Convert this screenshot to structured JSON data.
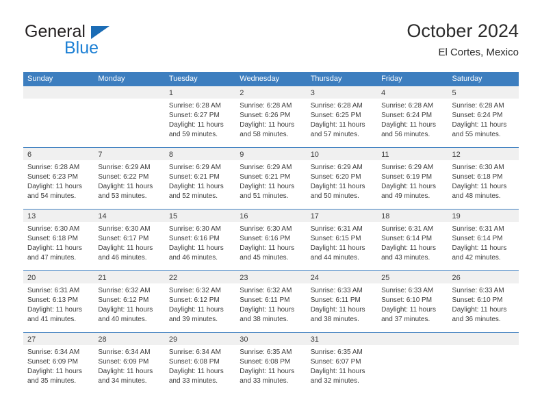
{
  "brand": {
    "name_part1": "General",
    "name_part2": "Blue",
    "triangle_icon": "blue-triangle-logo-icon",
    "color_dark": "#231f20",
    "color_blue": "#1b7fd4"
  },
  "header": {
    "title": "October 2024",
    "subtitle": "El Cortes, Mexico"
  },
  "theme": {
    "header_bar": "#3d7ebf",
    "day_band": "#f0f0f0",
    "text": "#3a3a3a"
  },
  "calendar": {
    "weekday_headers": [
      "Sunday",
      "Monday",
      "Tuesday",
      "Wednesday",
      "Thursday",
      "Friday",
      "Saturday"
    ],
    "weeks": [
      [
        {
          "day": "",
          "sunrise": "",
          "sunset": "",
          "daylight_line1": "",
          "daylight_line2": "",
          "empty": true
        },
        {
          "day": "",
          "sunrise": "",
          "sunset": "",
          "daylight_line1": "",
          "daylight_line2": "",
          "empty": true
        },
        {
          "day": "1",
          "sunrise": "Sunrise: 6:28 AM",
          "sunset": "Sunset: 6:27 PM",
          "daylight_line1": "Daylight: 11 hours",
          "daylight_line2": "and 59 minutes."
        },
        {
          "day": "2",
          "sunrise": "Sunrise: 6:28 AM",
          "sunset": "Sunset: 6:26 PM",
          "daylight_line1": "Daylight: 11 hours",
          "daylight_line2": "and 58 minutes."
        },
        {
          "day": "3",
          "sunrise": "Sunrise: 6:28 AM",
          "sunset": "Sunset: 6:25 PM",
          "daylight_line1": "Daylight: 11 hours",
          "daylight_line2": "and 57 minutes."
        },
        {
          "day": "4",
          "sunrise": "Sunrise: 6:28 AM",
          "sunset": "Sunset: 6:24 PM",
          "daylight_line1": "Daylight: 11 hours",
          "daylight_line2": "and 56 minutes."
        },
        {
          "day": "5",
          "sunrise": "Sunrise: 6:28 AM",
          "sunset": "Sunset: 6:24 PM",
          "daylight_line1": "Daylight: 11 hours",
          "daylight_line2": "and 55 minutes."
        }
      ],
      [
        {
          "day": "6",
          "sunrise": "Sunrise: 6:28 AM",
          "sunset": "Sunset: 6:23 PM",
          "daylight_line1": "Daylight: 11 hours",
          "daylight_line2": "and 54 minutes."
        },
        {
          "day": "7",
          "sunrise": "Sunrise: 6:29 AM",
          "sunset": "Sunset: 6:22 PM",
          "daylight_line1": "Daylight: 11 hours",
          "daylight_line2": "and 53 minutes."
        },
        {
          "day": "8",
          "sunrise": "Sunrise: 6:29 AM",
          "sunset": "Sunset: 6:21 PM",
          "daylight_line1": "Daylight: 11 hours",
          "daylight_line2": "and 52 minutes."
        },
        {
          "day": "9",
          "sunrise": "Sunrise: 6:29 AM",
          "sunset": "Sunset: 6:21 PM",
          "daylight_line1": "Daylight: 11 hours",
          "daylight_line2": "and 51 minutes."
        },
        {
          "day": "10",
          "sunrise": "Sunrise: 6:29 AM",
          "sunset": "Sunset: 6:20 PM",
          "daylight_line1": "Daylight: 11 hours",
          "daylight_line2": "and 50 minutes."
        },
        {
          "day": "11",
          "sunrise": "Sunrise: 6:29 AM",
          "sunset": "Sunset: 6:19 PM",
          "daylight_line1": "Daylight: 11 hours",
          "daylight_line2": "and 49 minutes."
        },
        {
          "day": "12",
          "sunrise": "Sunrise: 6:30 AM",
          "sunset": "Sunset: 6:18 PM",
          "daylight_line1": "Daylight: 11 hours",
          "daylight_line2": "and 48 minutes."
        }
      ],
      [
        {
          "day": "13",
          "sunrise": "Sunrise: 6:30 AM",
          "sunset": "Sunset: 6:18 PM",
          "daylight_line1": "Daylight: 11 hours",
          "daylight_line2": "and 47 minutes."
        },
        {
          "day": "14",
          "sunrise": "Sunrise: 6:30 AM",
          "sunset": "Sunset: 6:17 PM",
          "daylight_line1": "Daylight: 11 hours",
          "daylight_line2": "and 46 minutes."
        },
        {
          "day": "15",
          "sunrise": "Sunrise: 6:30 AM",
          "sunset": "Sunset: 6:16 PM",
          "daylight_line1": "Daylight: 11 hours",
          "daylight_line2": "and 46 minutes."
        },
        {
          "day": "16",
          "sunrise": "Sunrise: 6:30 AM",
          "sunset": "Sunset: 6:16 PM",
          "daylight_line1": "Daylight: 11 hours",
          "daylight_line2": "and 45 minutes."
        },
        {
          "day": "17",
          "sunrise": "Sunrise: 6:31 AM",
          "sunset": "Sunset: 6:15 PM",
          "daylight_line1": "Daylight: 11 hours",
          "daylight_line2": "and 44 minutes."
        },
        {
          "day": "18",
          "sunrise": "Sunrise: 6:31 AM",
          "sunset": "Sunset: 6:14 PM",
          "daylight_line1": "Daylight: 11 hours",
          "daylight_line2": "and 43 minutes."
        },
        {
          "day": "19",
          "sunrise": "Sunrise: 6:31 AM",
          "sunset": "Sunset: 6:14 PM",
          "daylight_line1": "Daylight: 11 hours",
          "daylight_line2": "and 42 minutes."
        }
      ],
      [
        {
          "day": "20",
          "sunrise": "Sunrise: 6:31 AM",
          "sunset": "Sunset: 6:13 PM",
          "daylight_line1": "Daylight: 11 hours",
          "daylight_line2": "and 41 minutes."
        },
        {
          "day": "21",
          "sunrise": "Sunrise: 6:32 AM",
          "sunset": "Sunset: 6:12 PM",
          "daylight_line1": "Daylight: 11 hours",
          "daylight_line2": "and 40 minutes."
        },
        {
          "day": "22",
          "sunrise": "Sunrise: 6:32 AM",
          "sunset": "Sunset: 6:12 PM",
          "daylight_line1": "Daylight: 11 hours",
          "daylight_line2": "and 39 minutes."
        },
        {
          "day": "23",
          "sunrise": "Sunrise: 6:32 AM",
          "sunset": "Sunset: 6:11 PM",
          "daylight_line1": "Daylight: 11 hours",
          "daylight_line2": "and 38 minutes."
        },
        {
          "day": "24",
          "sunrise": "Sunrise: 6:33 AM",
          "sunset": "Sunset: 6:11 PM",
          "daylight_line1": "Daylight: 11 hours",
          "daylight_line2": "and 38 minutes."
        },
        {
          "day": "25",
          "sunrise": "Sunrise: 6:33 AM",
          "sunset": "Sunset: 6:10 PM",
          "daylight_line1": "Daylight: 11 hours",
          "daylight_line2": "and 37 minutes."
        },
        {
          "day": "26",
          "sunrise": "Sunrise: 6:33 AM",
          "sunset": "Sunset: 6:10 PM",
          "daylight_line1": "Daylight: 11 hours",
          "daylight_line2": "and 36 minutes."
        }
      ],
      [
        {
          "day": "27",
          "sunrise": "Sunrise: 6:34 AM",
          "sunset": "Sunset: 6:09 PM",
          "daylight_line1": "Daylight: 11 hours",
          "daylight_line2": "and 35 minutes."
        },
        {
          "day": "28",
          "sunrise": "Sunrise: 6:34 AM",
          "sunset": "Sunset: 6:09 PM",
          "daylight_line1": "Daylight: 11 hours",
          "daylight_line2": "and 34 minutes."
        },
        {
          "day": "29",
          "sunrise": "Sunrise: 6:34 AM",
          "sunset": "Sunset: 6:08 PM",
          "daylight_line1": "Daylight: 11 hours",
          "daylight_line2": "and 33 minutes."
        },
        {
          "day": "30",
          "sunrise": "Sunrise: 6:35 AM",
          "sunset": "Sunset: 6:08 PM",
          "daylight_line1": "Daylight: 11 hours",
          "daylight_line2": "and 33 minutes."
        },
        {
          "day": "31",
          "sunrise": "Sunrise: 6:35 AM",
          "sunset": "Sunset: 6:07 PM",
          "daylight_line1": "Daylight: 11 hours",
          "daylight_line2": "and 32 minutes."
        },
        {
          "day": "",
          "sunrise": "",
          "sunset": "",
          "daylight_line1": "",
          "daylight_line2": "",
          "empty": true
        },
        {
          "day": "",
          "sunrise": "",
          "sunset": "",
          "daylight_line1": "",
          "daylight_line2": "",
          "empty": true
        }
      ]
    ]
  }
}
